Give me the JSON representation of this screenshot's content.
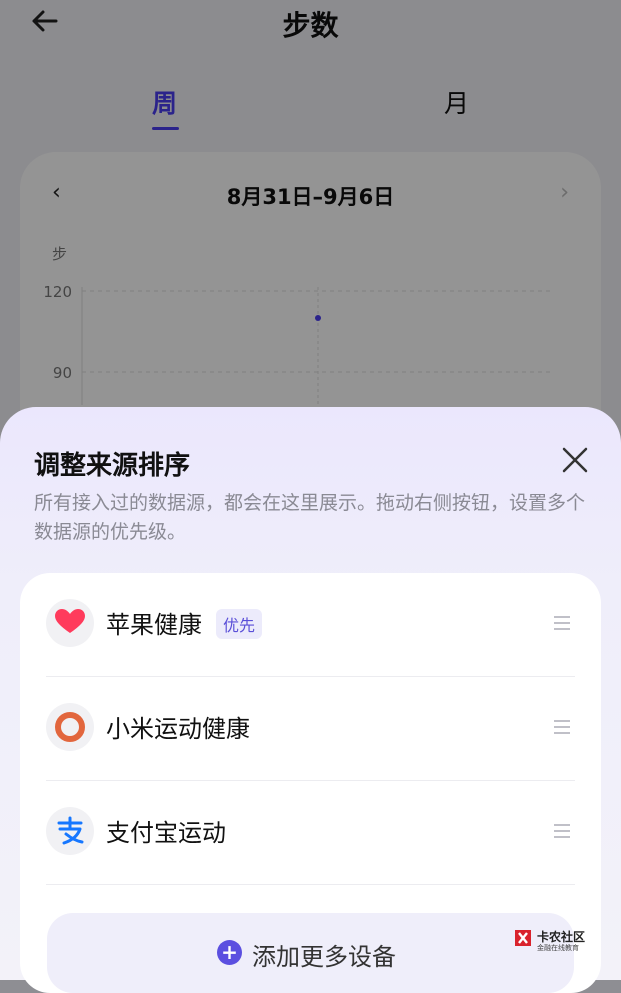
{
  "header": {
    "title": "步数"
  },
  "tabs": [
    {
      "label": "周"
    },
    {
      "label": "月"
    }
  ],
  "card": {
    "date_range": "8月31日–9月6日",
    "unit": "步",
    "chart_data": {
      "type": "scatter",
      "ylabel": "步",
      "y_ticks": [
        120,
        90
      ],
      "points": [
        {
          "y": 110
        }
      ]
    }
  },
  "sheet": {
    "title": "调整来源排序",
    "description": "所有接入过的数据源，都会在这里展示。拖动右侧按钮，设置多个数据源的优先级。",
    "sources": [
      {
        "name": "苹果健康",
        "badge": "优先",
        "icon": "heart-icon"
      },
      {
        "name": "小米运动健康",
        "badge": "",
        "icon": "ring-icon"
      },
      {
        "name": "支付宝运动",
        "badge": "",
        "icon": "alipay-icon"
      }
    ],
    "add_label": "添加更多设备"
  },
  "watermark": {
    "name": "卡农社区",
    "sub": "金融在线教育"
  },
  "colors": {
    "accent": "#4a3df0",
    "heart": "#ff3b5c",
    "ring": "#e2663d",
    "alipay": "#1677ff"
  }
}
